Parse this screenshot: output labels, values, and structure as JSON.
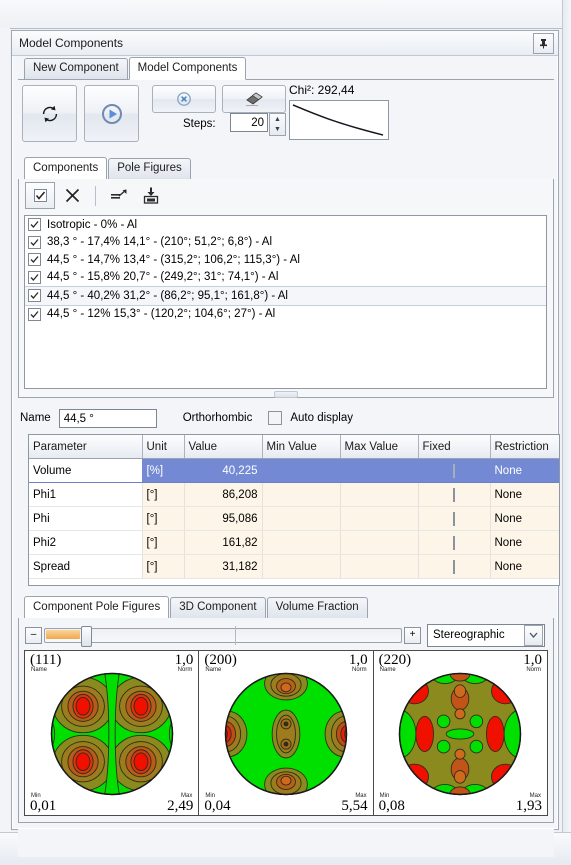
{
  "panel": {
    "title": "Model Components",
    "pin_icon": "pin-icon"
  },
  "outer_tabs": [
    {
      "label": "New Component",
      "active": false
    },
    {
      "label": "Model Components",
      "active": true
    }
  ],
  "toolbar": {
    "refresh_icon": "refresh-icon",
    "run_icon": "play-icon",
    "cancel_icon": "cancel-circle-icon",
    "erase_icon": "eraser-icon",
    "steps_label": "Steps:",
    "steps_value": "20",
    "spinner_up": "▲",
    "spinner_down": "▼",
    "chi_label": "Chi²: 292,44"
  },
  "inner_tabs": [
    {
      "label": "Components",
      "active": true
    },
    {
      "label": "Pole Figures",
      "active": false
    }
  ],
  "list_toolbar": {
    "select_all_icon": "checkbox-check-icon",
    "delete_icon": "close-x-icon",
    "export_icon": "export-arrow-icon",
    "import_icon": "import-disk-icon"
  },
  "components": [
    {
      "label": "Isotropic - 0% - Al",
      "checked": true,
      "selected": false
    },
    {
      "label": "38,3 ° - 17,4% 14,1° - (210°; 51,2°; 6,8°) - Al",
      "checked": true,
      "selected": false
    },
    {
      "label": "44,5 ° - 14,7% 13,4° - (315,2°; 106,2°; 115,3°) - Al",
      "checked": true,
      "selected": false
    },
    {
      "label": "44,5 ° - 15,8% 20,7° - (249,2°; 31°; 74,1°) - Al",
      "checked": true,
      "selected": false
    },
    {
      "label": "44,5 ° - 40,2% 31,2° - (86,2°; 95,1°; 161,8°) - Al",
      "checked": true,
      "selected": true
    },
    {
      "label": "44,5 ° - 12% 15,3° - (120,2°; 104,6°; 27°) - Al",
      "checked": true,
      "selected": false
    }
  ],
  "name_row": {
    "name_label": "Name",
    "name_value": "44,5 °",
    "symmetry_label": "Orthorhombic",
    "auto_display_label": "Auto display",
    "auto_display_checked": false
  },
  "param_table": {
    "columns": [
      "Parameter",
      "Unit",
      "Value",
      "Min Value",
      "Max Value",
      "Fixed",
      "Restriction"
    ],
    "rows": [
      {
        "parameter": "Volume",
        "unit": "[%]",
        "value": "40,225",
        "min": "",
        "max": "",
        "fixed": false,
        "restriction": "None",
        "selected": true
      },
      {
        "parameter": "Phi1",
        "unit": "[°]",
        "value": "86,208",
        "min": "",
        "max": "",
        "fixed": false,
        "restriction": "None",
        "selected": false
      },
      {
        "parameter": "Phi",
        "unit": "[°]",
        "value": "95,086",
        "min": "",
        "max": "",
        "fixed": false,
        "restriction": "None",
        "selected": false
      },
      {
        "parameter": "Phi2",
        "unit": "[°]",
        "value": "161,82",
        "min": "",
        "max": "",
        "fixed": false,
        "restriction": "None",
        "selected": false
      },
      {
        "parameter": "Spread",
        "unit": "[°]",
        "value": "31,182",
        "min": "",
        "max": "",
        "fixed": false,
        "restriction": "None",
        "selected": false
      }
    ]
  },
  "bottom_tabs": [
    {
      "label": "Component Pole Figures",
      "active": true
    },
    {
      "label": "3D Component",
      "active": false
    },
    {
      "label": "Volume Fraction",
      "active": false
    }
  ],
  "pf_toolbar": {
    "minus_label": "–",
    "plus_label": "+",
    "projection_value": "Stereographic",
    "dropdown_icon": "chevron-down-icon"
  },
  "pole_figures": [
    {
      "hkl": "(111)",
      "norm": "1,0",
      "min": "0,01",
      "max": "2,49",
      "name_tag": "Name",
      "norm_tag": "Norm",
      "min_tag": "Min",
      "max_tag": "Max"
    },
    {
      "hkl": "(200)",
      "norm": "1,0",
      "min": "0,04",
      "max": "5,54",
      "name_tag": "Name",
      "norm_tag": "Norm",
      "min_tag": "Min",
      "max_tag": "Max"
    },
    {
      "hkl": "(220)",
      "norm": "1,0",
      "min": "0,08",
      "max": "1,93",
      "name_tag": "Name",
      "norm_tag": "Norm",
      "min_tag": "Min",
      "max_tag": "Max"
    }
  ],
  "colors": {
    "selection_blue": "#7389d3",
    "row_cream": "#fdf6e8",
    "pf_low": "#00e000",
    "pf_mid": "#8a8a1e",
    "pf_high": "#f01000",
    "slider_orange": "#f0a94e"
  }
}
